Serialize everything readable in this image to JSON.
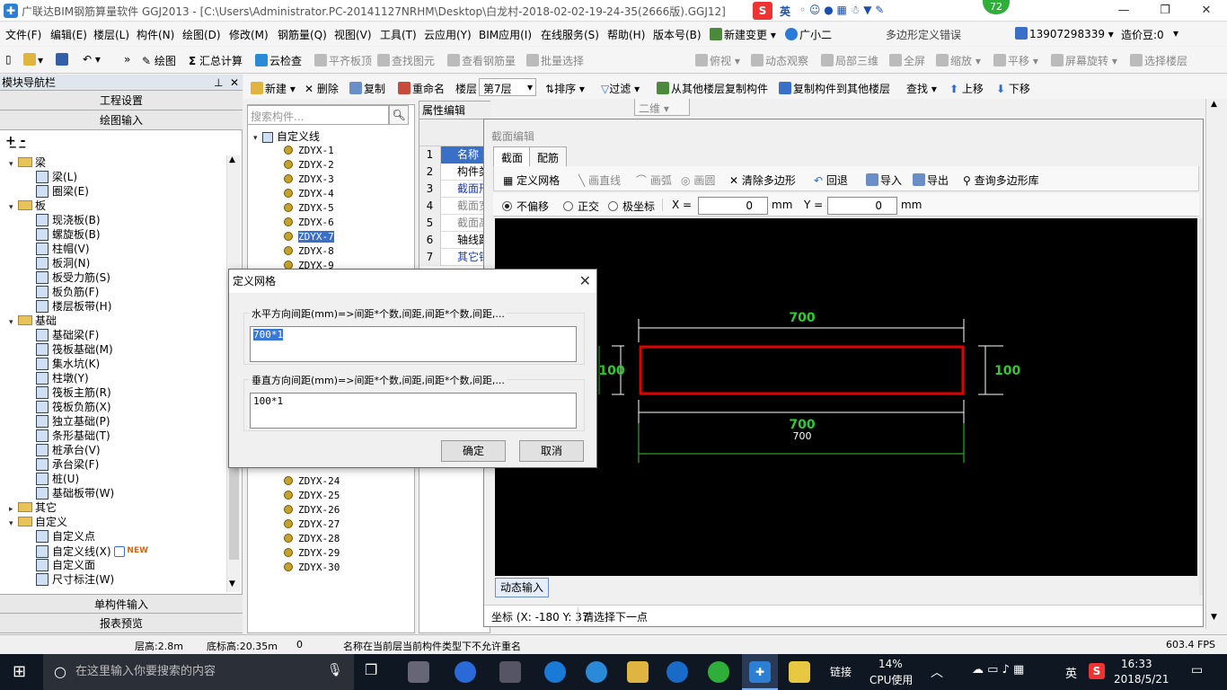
{
  "window": {
    "title": "广联达BIM钢筋算量软件 GGJ2013 - [C:\\Users\\Administrator.PC-20141127NRHM\\Desktop\\白龙村-2018-02-02-19-24-35(2666版).GGJ12]",
    "badge": "72",
    "ime": "英"
  },
  "menu": [
    "文件(F)",
    "编辑(E)",
    "楼层(L)",
    "构件(N)",
    "绘图(D)",
    "修改(M)",
    "钢筋量(Q)",
    "视图(V)",
    "工具(T)",
    "云应用(Y)",
    "BIM应用(I)",
    "在线服务(S)",
    "帮助(H)",
    "版本号(B)",
    "新建变更",
    "广小二",
    "多边形定义错误",
    "13907298339",
    "造价豆:0"
  ],
  "toolbar1": [
    "绘图",
    "汇总计算",
    "云检查",
    "平齐板顶",
    "查找图元",
    "查看钢筋量",
    "批量选择",
    "二维",
    "俯视",
    "动态观察",
    "局部三维",
    "全屏",
    "缩放",
    "平移",
    "屏幕旋转",
    "选择楼层"
  ],
  "toolbar2": [
    "新建",
    "删除",
    "复制",
    "重命名",
    "楼层",
    "第7层",
    "排序",
    "过滤",
    "从其他楼层复制构件",
    "复制构件到其他楼层",
    "查找",
    "上移",
    "下移"
  ],
  "nav": {
    "title": "模块导航栏",
    "buttons": [
      "工程设置",
      "绘图输入",
      "单构件输入",
      "报表预览"
    ],
    "tree": [
      {
        "t": "梁",
        "lvl": 0,
        "f": 1
      },
      {
        "t": "梁(L)",
        "lvl": 1
      },
      {
        "t": "圈梁(E)",
        "lvl": 1
      },
      {
        "t": "板",
        "lvl": 0,
        "f": 1
      },
      {
        "t": "现浇板(B)",
        "lvl": 1
      },
      {
        "t": "螺旋板(B)",
        "lvl": 1
      },
      {
        "t": "柱帽(V)",
        "lvl": 1
      },
      {
        "t": "板洞(N)",
        "lvl": 1
      },
      {
        "t": "板受力筋(S)",
        "lvl": 1
      },
      {
        "t": "板负筋(F)",
        "lvl": 1
      },
      {
        "t": "楼层板带(H)",
        "lvl": 1
      },
      {
        "t": "基础",
        "lvl": 0,
        "f": 1
      },
      {
        "t": "基础梁(F)",
        "lvl": 1
      },
      {
        "t": "筏板基础(M)",
        "lvl": 1
      },
      {
        "t": "集水坑(K)",
        "lvl": 1
      },
      {
        "t": "柱墩(Y)",
        "lvl": 1
      },
      {
        "t": "筏板主筋(R)",
        "lvl": 1
      },
      {
        "t": "筏板负筋(X)",
        "lvl": 1
      },
      {
        "t": "独立基础(P)",
        "lvl": 1
      },
      {
        "t": "条形基础(T)",
        "lvl": 1
      },
      {
        "t": "桩承台(V)",
        "lvl": 1
      },
      {
        "t": "承台梁(F)",
        "lvl": 1
      },
      {
        "t": "桩(U)",
        "lvl": 1
      },
      {
        "t": "基础板带(W)",
        "lvl": 1
      },
      {
        "t": "其它",
        "lvl": 0,
        "f": 1
      },
      {
        "t": "自定义",
        "lvl": 0,
        "f": 1
      },
      {
        "t": "自定义点",
        "lvl": 1
      },
      {
        "t": "自定义线(X)",
        "lvl": 1,
        "new": "NEW"
      },
      {
        "t": "自定义面",
        "lvl": 1
      },
      {
        "t": "尺寸标注(W)",
        "lvl": 1
      }
    ]
  },
  "components": {
    "search_placeholder": "搜索构件...",
    "root": "自定义线",
    "top": [
      "ZDYX-1",
      "ZDYX-2",
      "ZDYX-3",
      "ZDYX-4",
      "ZDYX-5",
      "ZDYX-6",
      "ZDYX-7",
      "ZDYX-8",
      "ZDYX-9"
    ],
    "bottom": [
      "ZDYX-24",
      "ZDYX-25",
      "ZDYX-26",
      "ZDYX-27",
      "ZDYX-28",
      "ZDYX-29",
      "ZDYX-30"
    ],
    "selected": "ZDYX-7"
  },
  "props": {
    "tab": "属性编辑",
    "rows": [
      {
        "n": "1",
        "v": "名称"
      },
      {
        "n": "2",
        "v": "构件类"
      },
      {
        "n": "3",
        "v": "截面形"
      },
      {
        "n": "4",
        "v": "截面宽"
      },
      {
        "n": "5",
        "v": "截面高"
      },
      {
        "n": "6",
        "v": "轴线距"
      },
      {
        "n": "7",
        "v": "其它钢"
      }
    ]
  },
  "section": {
    "title": "截面编辑",
    "tabs": [
      "截面",
      "配筋"
    ],
    "tools": [
      "定义网格",
      "画直线",
      "画弧",
      "画圆",
      "清除多边形",
      "回退",
      "导入",
      "导出",
      "查询多边形库"
    ],
    "opts": [
      "不偏移",
      "正交",
      "极坐标"
    ],
    "x_label": "X =",
    "y_label": "Y =",
    "x_value": "0",
    "y_value": "0",
    "unit": "mm",
    "dim_top": "700",
    "dim_left": "100",
    "dim_right": "100",
    "dim_bottom": "700",
    "dim_bottom2": "700",
    "dyn_btn": "动态输入",
    "coord_label": "坐标 (X: -180 Y: 37",
    "coord_prompt": "请选择下一点"
  },
  "dialog": {
    "title": "定义网格",
    "h_label": "水平方向间距(mm)=>间距*个数,间距,间距*个数,间距,...",
    "h_value": "700*1",
    "v_label": "垂直方向间距(mm)=>间距*个数,间距,间距*个数,间距,...",
    "v_value": "100*1",
    "ok": "确定",
    "cancel": "取消"
  },
  "status": {
    "floor_h": "层高:2.8m",
    "base_h": "底标高:20.35m",
    "zero": "0",
    "msg": "名称在当前层当前构件类型下不允许重名",
    "fps": "603.4 FPS"
  },
  "taskbar": {
    "search": "在这里输入你要搜索的内容",
    "link": "链接",
    "cpu": "14%",
    "cpu_label": "CPU使用",
    "lang": "英",
    "time": "16:33",
    "date": "2018/5/21"
  },
  "colors": {
    "accent": "#3a6fc8",
    "rect": "#e00000",
    "dim": "#2ecc2e"
  }
}
